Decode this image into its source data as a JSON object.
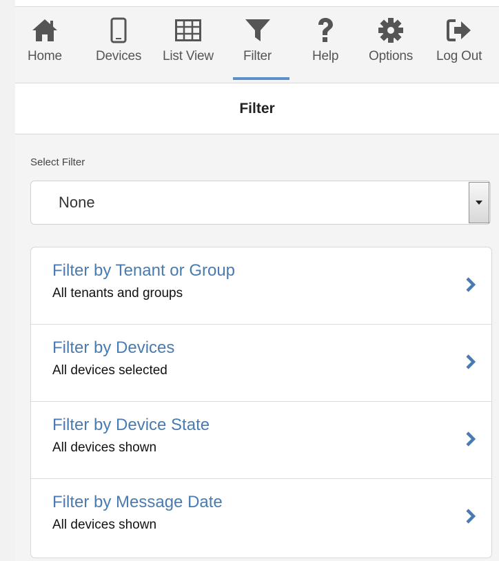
{
  "nav": {
    "items": [
      {
        "label": "Home",
        "icon": "home-icon"
      },
      {
        "label": "Devices",
        "icon": "device-icon"
      },
      {
        "label": "List View",
        "icon": "grid-icon"
      },
      {
        "label": "Filter",
        "icon": "filter-icon",
        "active": true
      },
      {
        "label": "Help",
        "icon": "help-icon"
      },
      {
        "label": "Options",
        "icon": "gear-icon"
      },
      {
        "label": "Log Out",
        "icon": "logout-icon"
      }
    ]
  },
  "page": {
    "title": "Filter"
  },
  "select_filter": {
    "label": "Select Filter",
    "value": "None"
  },
  "filters": [
    {
      "title": "Filter by Tenant or Group",
      "subtitle": "All tenants and groups"
    },
    {
      "title": "Filter by Devices",
      "subtitle": "All devices selected"
    },
    {
      "title": "Filter by Device State",
      "subtitle": "All devices shown"
    },
    {
      "title": "Filter by Message Date",
      "subtitle": "All devices shown"
    }
  ],
  "colors": {
    "accent": "#5b8fc9",
    "link": "#4a7bb0",
    "icon": "#555555"
  }
}
